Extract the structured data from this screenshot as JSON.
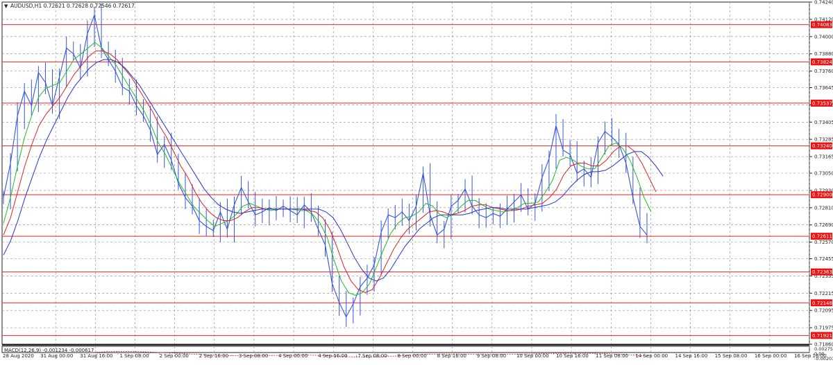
{
  "header": {
    "title": "AUDUSD,H1  0.72621 0.72628 0.72546 0.72617"
  },
  "macd_label": "MACD(12,26,9) -0.001234 -0.000617",
  "colors": {
    "price": "#3355dd",
    "ma_fast": "#22bb22",
    "ma_mid": "#dd2222",
    "ma_slow": "#2233cc",
    "level_line": "#ee2222",
    "level_tag_bg": "#ee1111",
    "grid": "#888888",
    "macd_hist": "#a0a0a0",
    "macd_signal": "#dd2222"
  },
  "chart_data": {
    "type": "line",
    "instrument": "AUDUSD",
    "timeframe": "H1",
    "ylim": [
      0.7186,
      0.7424
    ],
    "y_ticks": [
      "0.74240",
      "0.74120",
      "0.74000",
      "0.73880",
      "0.73760",
      "0.73645",
      "0.73525",
      "0.73405",
      "0.73285",
      "0.73165",
      "0.73050",
      "0.72930",
      "0.72810",
      "0.72690",
      "0.72570",
      "0.72455",
      "0.72335",
      "0.72215",
      "0.72095",
      "0.71975",
      "0.71860"
    ],
    "x_ticks": [
      "28 Aug 2020",
      "31 Aug 00:00",
      "31 Aug 16:00",
      "1 Sep 08:00",
      "2 Sep 00:00",
      "2 Sep 16:00",
      "3 Sep 08:00",
      "4 Sep 00:00",
      "4 Sep 16:00",
      "7 Sep 08:00",
      "8 Sep 00:00",
      "8 Sep 16:00",
      "9 Sep 08:00",
      "10 Sep 00:00",
      "10 Sep 16:00",
      "11 Sep 08:00",
      "14 Sep 00:00",
      "14 Sep 16:00",
      "15 Sep 08:00",
      "16 Sep 00:00",
      "16 Sep 16:00"
    ],
    "horizontal_levels": [
      "0.74083",
      "0.73824",
      "0.73537",
      "0.73240",
      "0.72900",
      "0.72611",
      "0.72363",
      "0.72148",
      "0.71921"
    ],
    "price_series": [
      0.7288,
      0.7312,
      0.7345,
      0.7362,
      0.7352,
      0.7375,
      0.7368,
      0.7352,
      0.7372,
      0.7392,
      0.7388,
      0.7378,
      0.7402,
      0.7415,
      0.7392,
      0.7384,
      0.7376,
      0.7365,
      0.7362,
      0.7352,
      0.7345,
      0.7335,
      0.7318,
      0.7325,
      0.7314,
      0.7298,
      0.7288,
      0.7282,
      0.7272,
      0.7268,
      0.7265,
      0.7278,
      0.7266,
      0.7283,
      0.7295,
      0.7285,
      0.7276,
      0.7278,
      0.7281,
      0.7279,
      0.7282,
      0.7279,
      0.7276,
      0.7283,
      0.7278,
      0.7266,
      0.7255,
      0.7228,
      0.7215,
      0.7205,
      0.7214,
      0.7226,
      0.7232,
      0.7241,
      0.7264,
      0.7276,
      0.7274,
      0.7278,
      0.7272,
      0.7282,
      0.7305,
      0.7276,
      0.7262,
      0.7266,
      0.7282,
      0.7286,
      0.7294,
      0.7282,
      0.7276,
      0.7274,
      0.7277,
      0.7275,
      0.728,
      0.7285,
      0.729,
      0.728,
      0.7284,
      0.7302,
      0.7315,
      0.7338,
      0.7321,
      0.7318,
      0.7305,
      0.7308,
      0.7302,
      0.7326,
      0.7334,
      0.733,
      0.7325,
      0.7312,
      0.7288,
      0.7268,
      0.7262
    ],
    "ma_fast": [
      0.727,
      0.7288,
      0.731,
      0.733,
      0.7345,
      0.7358,
      0.7364,
      0.7366,
      0.7368,
      0.7376,
      0.7384,
      0.7388,
      0.7392,
      0.7396,
      0.7392,
      0.7386,
      0.738,
      0.7372,
      0.7364,
      0.7356,
      0.7348,
      0.7338,
      0.7326,
      0.7318,
      0.7308,
      0.7298,
      0.729,
      0.7282,
      0.7277,
      0.7272,
      0.7268,
      0.727,
      0.7272,
      0.7276,
      0.7282,
      0.7284,
      0.7282,
      0.728,
      0.7279,
      0.728,
      0.728,
      0.728,
      0.7279,
      0.7279,
      0.7276,
      0.727,
      0.726,
      0.7244,
      0.723,
      0.7222,
      0.722,
      0.7222,
      0.7228,
      0.724,
      0.7252,
      0.7263,
      0.727,
      0.7274,
      0.7275,
      0.7278,
      0.7284,
      0.7282,
      0.7276,
      0.7274,
      0.7277,
      0.7282,
      0.7286,
      0.7286,
      0.7283,
      0.728,
      0.7279,
      0.7278,
      0.7279,
      0.7281,
      0.7284,
      0.7284,
      0.7285,
      0.7292,
      0.73,
      0.7314,
      0.7316,
      0.7314,
      0.731,
      0.7308,
      0.7308,
      0.7316,
      0.7324,
      0.7326,
      0.7322,
      0.7314,
      0.7302,
      0.7288,
      0.7278
    ],
    "ma_mid": [
      0.7262,
      0.7274,
      0.7292,
      0.731,
      0.7325,
      0.7338,
      0.7346,
      0.7352,
      0.7358,
      0.7366,
      0.7374,
      0.738,
      0.7386,
      0.739,
      0.739,
      0.7388,
      0.7384,
      0.7378,
      0.7372,
      0.7364,
      0.7356,
      0.7348,
      0.7338,
      0.733,
      0.732,
      0.731,
      0.7302,
      0.7292,
      0.7284,
      0.7278,
      0.7274,
      0.7272,
      0.7272,
      0.7274,
      0.7278,
      0.7281,
      0.7281,
      0.728,
      0.728,
      0.728,
      0.728,
      0.728,
      0.728,
      0.7279,
      0.7278,
      0.7274,
      0.7266,
      0.7254,
      0.724,
      0.723,
      0.7224,
      0.7222,
      0.7224,
      0.7232,
      0.7242,
      0.7252,
      0.726,
      0.7266,
      0.727,
      0.7274,
      0.7278,
      0.7279,
      0.7278,
      0.7276,
      0.7277,
      0.7279,
      0.7282,
      0.7283,
      0.7283,
      0.7281,
      0.728,
      0.7279,
      0.7279,
      0.728,
      0.7282,
      0.7283,
      0.7284,
      0.7288,
      0.7294,
      0.7304,
      0.731,
      0.7312,
      0.7312,
      0.731,
      0.731,
      0.7314,
      0.732,
      0.7324,
      0.7324,
      0.732,
      0.7312,
      0.7302,
      0.7292
    ],
    "ma_slow": [
      0.7248,
      0.7258,
      0.7272,
      0.7288,
      0.7302,
      0.7316,
      0.7328,
      0.7338,
      0.7348,
      0.7358,
      0.7366,
      0.7372,
      0.7378,
      0.7382,
      0.7384,
      0.7384,
      0.7382,
      0.7378,
      0.7372,
      0.7366,
      0.7358,
      0.735,
      0.7342,
      0.7334,
      0.7326,
      0.7318,
      0.731,
      0.7302,
      0.7294,
      0.7288,
      0.7283,
      0.728,
      0.7278,
      0.7277,
      0.7278,
      0.7279,
      0.728,
      0.728,
      0.728,
      0.728,
      0.728,
      0.728,
      0.728,
      0.728,
      0.728,
      0.7278,
      0.7274,
      0.7266,
      0.7256,
      0.7246,
      0.7238,
      0.7232,
      0.723,
      0.7232,
      0.7238,
      0.7246,
      0.7254,
      0.726,
      0.7266,
      0.727,
      0.7274,
      0.7276,
      0.7276,
      0.7276,
      0.7276,
      0.7277,
      0.7279,
      0.728,
      0.7281,
      0.7281,
      0.728,
      0.728,
      0.728,
      0.728,
      0.7281,
      0.7282,
      0.7283,
      0.7285,
      0.7289,
      0.7295,
      0.73,
      0.7304,
      0.7306,
      0.7306,
      0.7307,
      0.731,
      0.7314,
      0.7318,
      0.732,
      0.732,
      0.7316,
      0.731,
      0.7303
    ],
    "macd": {
      "ylim": [
        -0.002037,
        0.002751
      ],
      "y_ticks": [
        "0.002751",
        "0.00",
        "-0.002037"
      ],
      "histogram": [
        0.0011,
        0.0014,
        0.0016,
        0.0016,
        0.0015,
        0.0013,
        0.0011,
        0.0009,
        0.0006,
        0.0003,
        0.0001,
        -0.0001,
        -0.0003,
        -0.0004,
        -0.0005,
        -0.0005,
        -0.0004,
        -0.0003,
        -0.0002,
        -0.0001,
        -0.0001,
        0.0,
        -0.0002,
        -0.0005,
        -0.0008,
        -0.0011,
        -0.0012,
        -0.0011,
        -0.0009,
        -0.0006,
        -0.0003,
        0.0,
        0.0002,
        0.0003,
        0.0004,
        0.0003,
        0.0002,
        0.0002,
        0.0001,
        0.0002,
        0.0002,
        0.0002,
        0.0003,
        0.0004,
        0.0006,
        0.0007,
        0.0007,
        0.0006,
        0.0005,
        0.0006,
        0.0004,
        0.0002,
        -0.0002,
        -0.0006,
        -0.0012
      ],
      "signal": [
        0.0008,
        0.0011,
        0.0013,
        0.0014,
        0.0014,
        0.0013,
        0.0012,
        0.001,
        0.0008,
        0.0006,
        0.0003,
        0.0001,
        -0.0001,
        -0.0003,
        -0.0004,
        -0.0004,
        -0.0004,
        -0.0003,
        -0.0003,
        -0.0002,
        -0.0002,
        -0.0001,
        -0.0002,
        -0.0004,
        -0.0006,
        -0.0008,
        -0.001,
        -0.001,
        -0.0009,
        -0.0007,
        -0.0005,
        -0.0002,
        0.0,
        0.0002,
        0.0003,
        0.0003,
        0.0003,
        0.0002,
        0.0002,
        0.0002,
        0.0002,
        0.0002,
        0.0003,
        0.0004,
        0.0005,
        0.0006,
        0.0006,
        0.0006,
        0.0006,
        0.0006,
        0.0005,
        0.0003,
        0.0001,
        -0.0002,
        -0.0006
      ]
    }
  }
}
